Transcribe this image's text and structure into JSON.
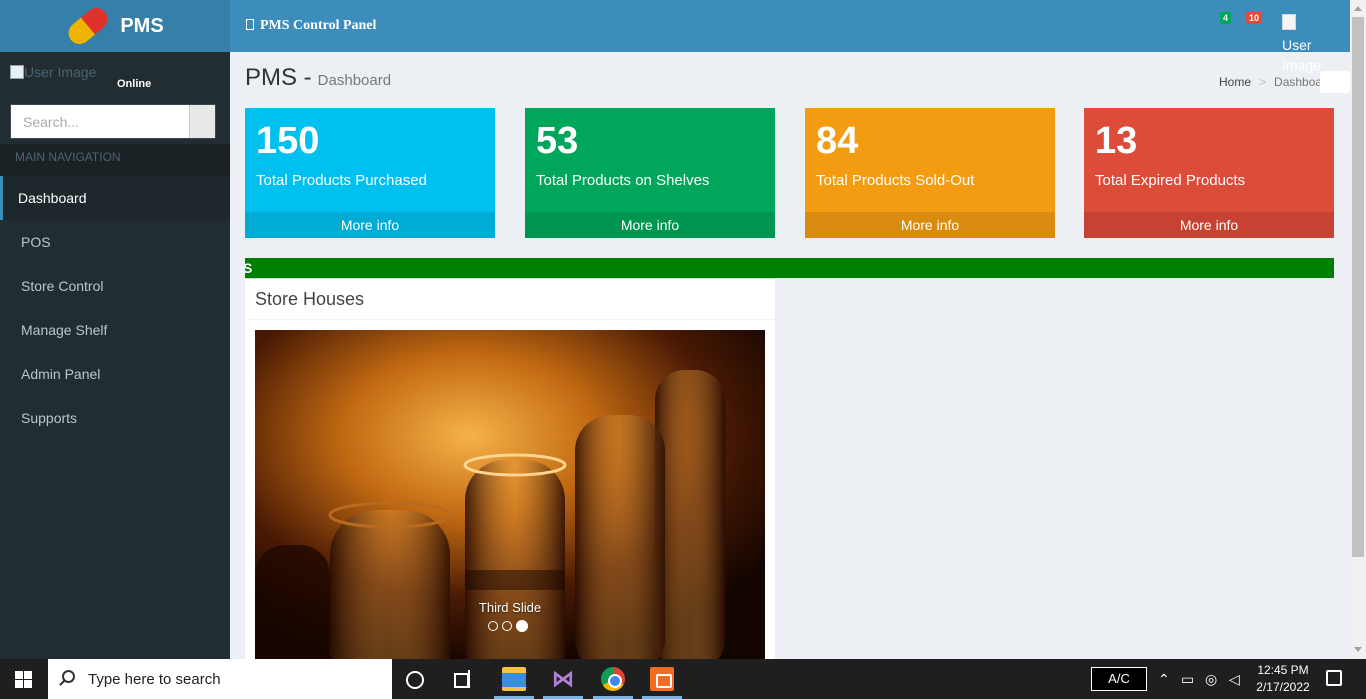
{
  "app": {
    "brand": "PMS",
    "nav_title": "PMS Control Panel",
    "badges": {
      "messages": "4",
      "alerts": "10"
    },
    "user_image_alt_top": "User Image"
  },
  "sidebar": {
    "user_image_alt": "User Image",
    "status": "Online",
    "search_placeholder": "Search...",
    "nav_header": "MAIN NAVIGATION",
    "items": [
      {
        "label": "Dashboard",
        "active": true
      },
      {
        "label": "POS"
      },
      {
        "label": "Store Control"
      },
      {
        "label": "Manage Shelf"
      },
      {
        "label": "Admin Panel"
      },
      {
        "label": "Supports"
      }
    ]
  },
  "content": {
    "title": "PMS -",
    "subtitle": "Dashboard",
    "breadcrumb": {
      "home": "Home",
      "sep": ">",
      "current": "Dashboard"
    },
    "stat_boxes": [
      {
        "value": "150",
        "label": "Total Products Purchased",
        "link": "More info",
        "color": "#00c0ef"
      },
      {
        "value": "53",
        "label": "Total Products on Shelves",
        "link": "More info",
        "color": "#00a65a"
      },
      {
        "value": "84",
        "label": "Total Products Sold-Out",
        "link": "More info",
        "color": "#f39c12"
      },
      {
        "value": "13",
        "label": "Total Expired Products",
        "link": "More info",
        "color": "#dd4b39"
      }
    ],
    "marquee_text": "S",
    "panel": {
      "title": "Store Houses",
      "carousel_caption": "Third Slide",
      "active_slide": 3,
      "slide_count": 3
    }
  },
  "taskbar": {
    "search_placeholder": "Type here to search",
    "ac_label": "A/C",
    "time": "12:45 PM",
    "date": "2/17/2022"
  }
}
